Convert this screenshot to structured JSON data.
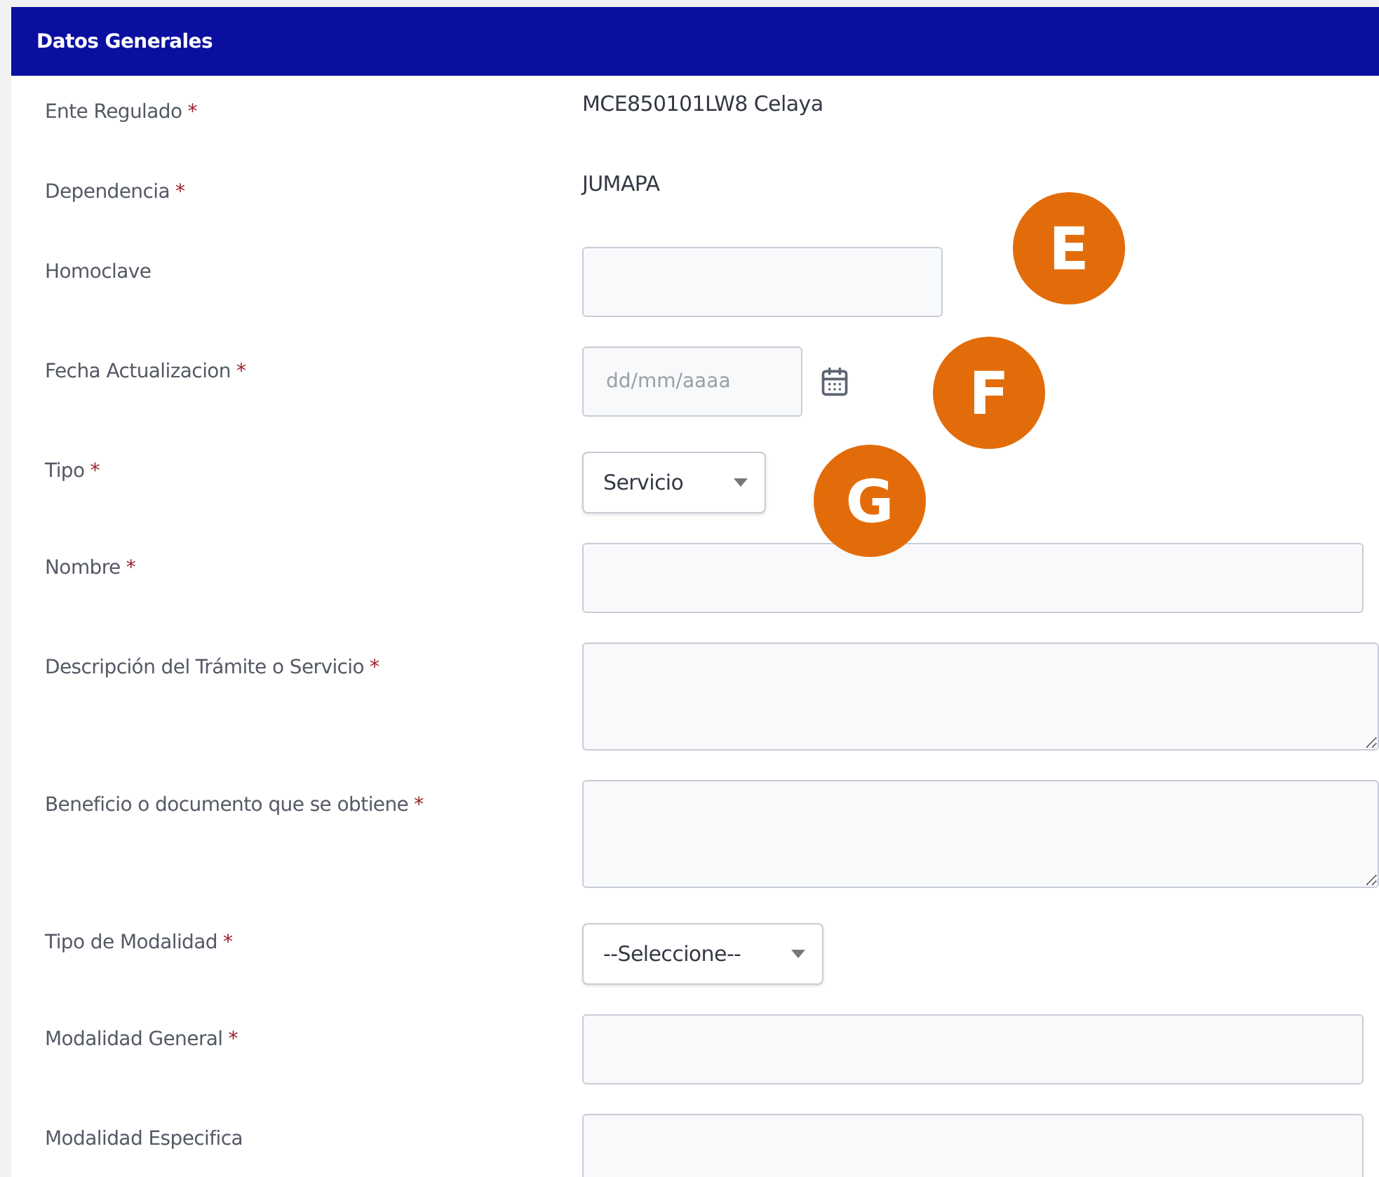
{
  "section": {
    "title": "Datos Generales"
  },
  "required_mark": "*",
  "fields": [
    {
      "kind": "text",
      "label": "Ente Regulado",
      "required": true,
      "value": "MCE850101LW8 Celaya"
    },
    {
      "kind": "text",
      "label": "Dependencia",
      "required": true,
      "value": "JUMAPA"
    },
    {
      "kind": "short",
      "label": "Homoclave",
      "required": false
    },
    {
      "kind": "date",
      "label": "Fecha Actualizacion",
      "required": true,
      "placeholder": "dd/mm/aaaa"
    },
    {
      "kind": "select",
      "label": "Tipo",
      "required": true,
      "value": "Servicio"
    },
    {
      "kind": "input",
      "label": "Nombre",
      "required": true
    },
    {
      "kind": "textarea",
      "label": "Descripción del Trámite o Servicio",
      "required": true
    },
    {
      "kind": "textarea",
      "label": "Beneficio o documento que se obtiene",
      "required": true
    },
    {
      "kind": "select",
      "label": "Tipo de Modalidad",
      "required": true,
      "value": "--Seleccione--"
    },
    {
      "kind": "input",
      "label": "Modalidad General",
      "required": true
    },
    {
      "kind": "input",
      "label": "Modalidad Especifica",
      "required": false
    }
  ],
  "markers": [
    {
      "letter": "E"
    },
    {
      "letter": "F"
    },
    {
      "letter": "G"
    }
  ]
}
